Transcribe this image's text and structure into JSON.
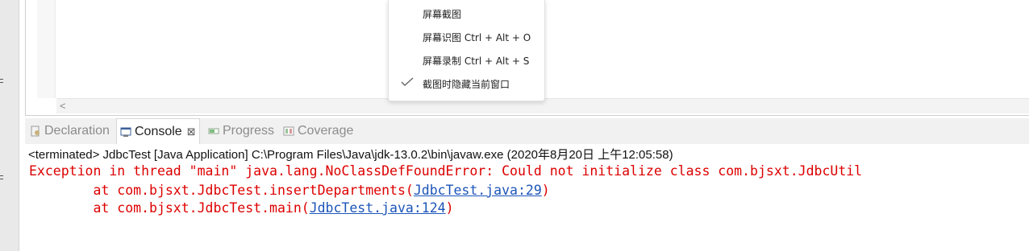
{
  "context_menu": {
    "items": [
      {
        "label": "屏幕截图"
      },
      {
        "label": "屏幕识图 Ctrl + Alt + O"
      },
      {
        "label": "屏幕录制 Ctrl + Alt + S"
      },
      {
        "label": "截图时隐藏当前窗口",
        "checked": true
      }
    ]
  },
  "editor": {
    "scroll_left_arrow": "<"
  },
  "tabs": [
    {
      "label": "Declaration",
      "icon": "declaration-icon",
      "active": false
    },
    {
      "label": "Console",
      "icon": "console-icon",
      "active": true,
      "close": "⊠"
    },
    {
      "label": "Progress",
      "icon": "progress-icon",
      "active": false
    },
    {
      "label": "Coverage",
      "icon": "coverage-icon",
      "active": false
    }
  ],
  "console": {
    "status_line": "<terminated> JdbcTest [Java Application] C:\\Program Files\\Java\\jdk-13.0.2\\bin\\javaw.exe (2020年8月20日 上午12:05:58)",
    "exception_line": "Exception in thread \"main\" java.lang.NoClassDefFoundError: Could not initialize class com.bjsxt.JdbcUtil",
    "stack": [
      {
        "prefix": "\tat com.bjsxt.JdbcTest.insertDepartments(",
        "link": "JdbcTest.java:29",
        "suffix": ")"
      },
      {
        "prefix": "\tat com.bjsxt.JdbcTest.main(",
        "link": "JdbcTest.java:124",
        "suffix": ")"
      }
    ],
    "colors": {
      "error": "#dd0000",
      "link": "#1c55b8"
    }
  }
}
